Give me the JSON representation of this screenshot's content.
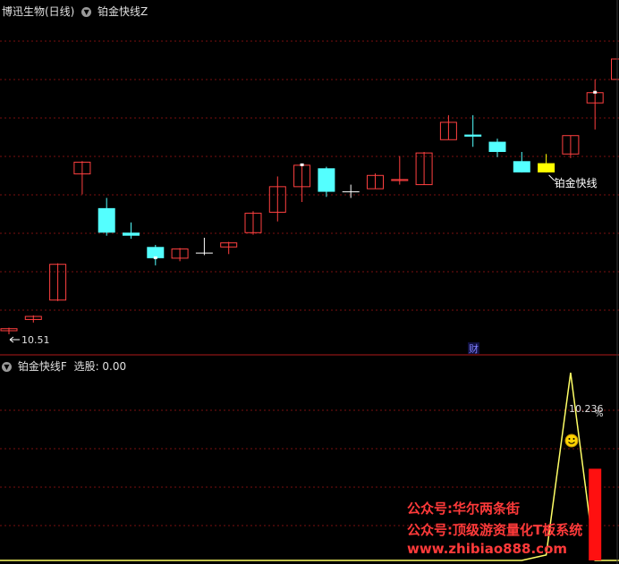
{
  "main_panel": {
    "stock_title": "博迅生物(日线)",
    "indicator_name": "铂金快线Z",
    "low_price_label": "10.51",
    "signal_label": "铂金快线",
    "finance_marker": "财"
  },
  "sub_panel": {
    "indicator_name": "铂金快线F",
    "select_label": "选股: 0.00",
    "value_label": "10.236",
    "value_suffix": "%",
    "smiley_icon": "smiley-face-icon"
  },
  "watermark": {
    "line1": "公众号:华尔两条街",
    "line2": "公众号:顶级游资量化T板系统",
    "line3": "www.zhibiao888.com"
  },
  "colors": {
    "up": "#ff4040",
    "down": "#54ffff",
    "highlight": "#ffff00",
    "grid": "#7a1010",
    "separator": "#b01a1a",
    "line": "#ffff66",
    "bar": "#ff1010"
  },
  "chart_data": [
    {
      "type": "candlestick",
      "title": "博迅生物(日线)",
      "candles": [
        {
          "o": 10.58,
          "c": 10.62,
          "h": 10.64,
          "l": 10.51,
          "color": "up"
        },
        {
          "o": 10.8,
          "c": 10.86,
          "h": 10.88,
          "l": 10.74,
          "color": "up"
        },
        {
          "o": 11.18,
          "c": 11.88,
          "h": 11.9,
          "l": 11.16,
          "color": "up"
        },
        {
          "o": 13.65,
          "c": 13.88,
          "h": 13.9,
          "l": 13.25,
          "color": "up"
        },
        {
          "o": 12.98,
          "c": 12.5,
          "h": 13.18,
          "l": 12.44,
          "color": "down"
        },
        {
          "o": 12.5,
          "c": 12.44,
          "h": 12.7,
          "l": 12.38,
          "color": "down"
        },
        {
          "o": 12.22,
          "c": 12.0,
          "h": 12.26,
          "l": 11.86,
          "color": "down"
        },
        {
          "o": 12.0,
          "c": 12.18,
          "h": 12.2,
          "l": 11.94,
          "color": "up"
        },
        {
          "o": 12.1,
          "c": 12.1,
          "h": 12.4,
          "l": 12.06,
          "color": "cross"
        },
        {
          "o": 12.22,
          "c": 12.3,
          "h": 12.32,
          "l": 12.08,
          "color": "up"
        },
        {
          "o": 12.5,
          "c": 12.88,
          "h": 12.92,
          "l": 12.46,
          "color": "up"
        },
        {
          "o": 12.9,
          "c": 13.4,
          "h": 13.6,
          "l": 12.72,
          "color": "up"
        },
        {
          "o": 13.4,
          "c": 13.82,
          "h": 13.84,
          "l": 13.1,
          "color": "up"
        },
        {
          "o": 13.76,
          "c": 13.3,
          "h": 13.79,
          "l": 13.2,
          "color": "down"
        },
        {
          "o": 13.3,
          "c": 13.3,
          "h": 13.44,
          "l": 13.18,
          "color": "cross"
        },
        {
          "o": 13.36,
          "c": 13.62,
          "h": 13.66,
          "l": 13.36,
          "color": "up"
        },
        {
          "o": 13.54,
          "c": 13.52,
          "h": 14.0,
          "l": 13.44,
          "color": "up"
        },
        {
          "o": 13.44,
          "c": 14.06,
          "h": 14.08,
          "l": 13.44,
          "color": "up"
        },
        {
          "o": 14.32,
          "c": 14.66,
          "h": 14.8,
          "l": 14.32,
          "color": "up"
        },
        {
          "o": 14.42,
          "c": 14.38,
          "h": 14.8,
          "l": 14.18,
          "color": "down"
        },
        {
          "o": 14.28,
          "c": 14.08,
          "h": 14.34,
          "l": 13.98,
          "color": "down"
        },
        {
          "o": 13.9,
          "c": 13.68,
          "h": 14.08,
          "l": 13.68,
          "color": "down"
        },
        {
          "o": 13.68,
          "c": 13.86,
          "h": 14.04,
          "l": 13.68,
          "color": "highlight"
        },
        {
          "o": 14.04,
          "c": 14.4,
          "h": 14.4,
          "l": 13.96,
          "color": "up"
        },
        {
          "o": 15.04,
          "c": 15.24,
          "h": 15.5,
          "l": 14.52,
          "color": "up"
        },
        {
          "o": 15.5,
          "c": 15.9,
          "h": 15.92,
          "l": 14.96,
          "color": "up"
        }
      ]
    },
    {
      "type": "line",
      "title": "铂金快线F",
      "values": [
        0,
        0,
        0,
        0,
        0,
        0,
        0,
        0,
        0,
        0,
        0,
        0,
        0,
        0,
        0,
        0,
        0,
        0,
        0,
        0,
        0,
        0,
        0.3,
        10.236,
        0,
        0
      ],
      "bar_values": [
        0,
        0,
        0,
        0,
        0,
        0,
        0,
        0,
        0,
        0,
        0,
        0,
        0,
        0,
        0,
        0,
        0,
        0,
        0,
        0,
        0,
        0,
        0,
        0,
        5.0,
        0
      ]
    }
  ]
}
